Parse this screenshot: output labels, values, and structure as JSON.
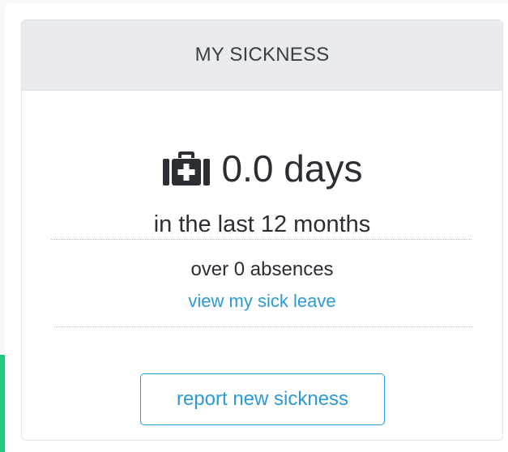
{
  "widget": {
    "title": "MY SICKNESS",
    "icon": "medical-kit-icon",
    "days_value": "0.0 days",
    "period_text": "in the last 12 months",
    "absences_text": "over 0 absences",
    "view_link_label": "view my sick leave",
    "report_button_label": "report new sickness"
  },
  "colors": {
    "header_background": "#e9ebee",
    "link_accent": "#2a9ad6",
    "text_primary": "#2b2f33",
    "side_accent": "#1ec97e"
  }
}
